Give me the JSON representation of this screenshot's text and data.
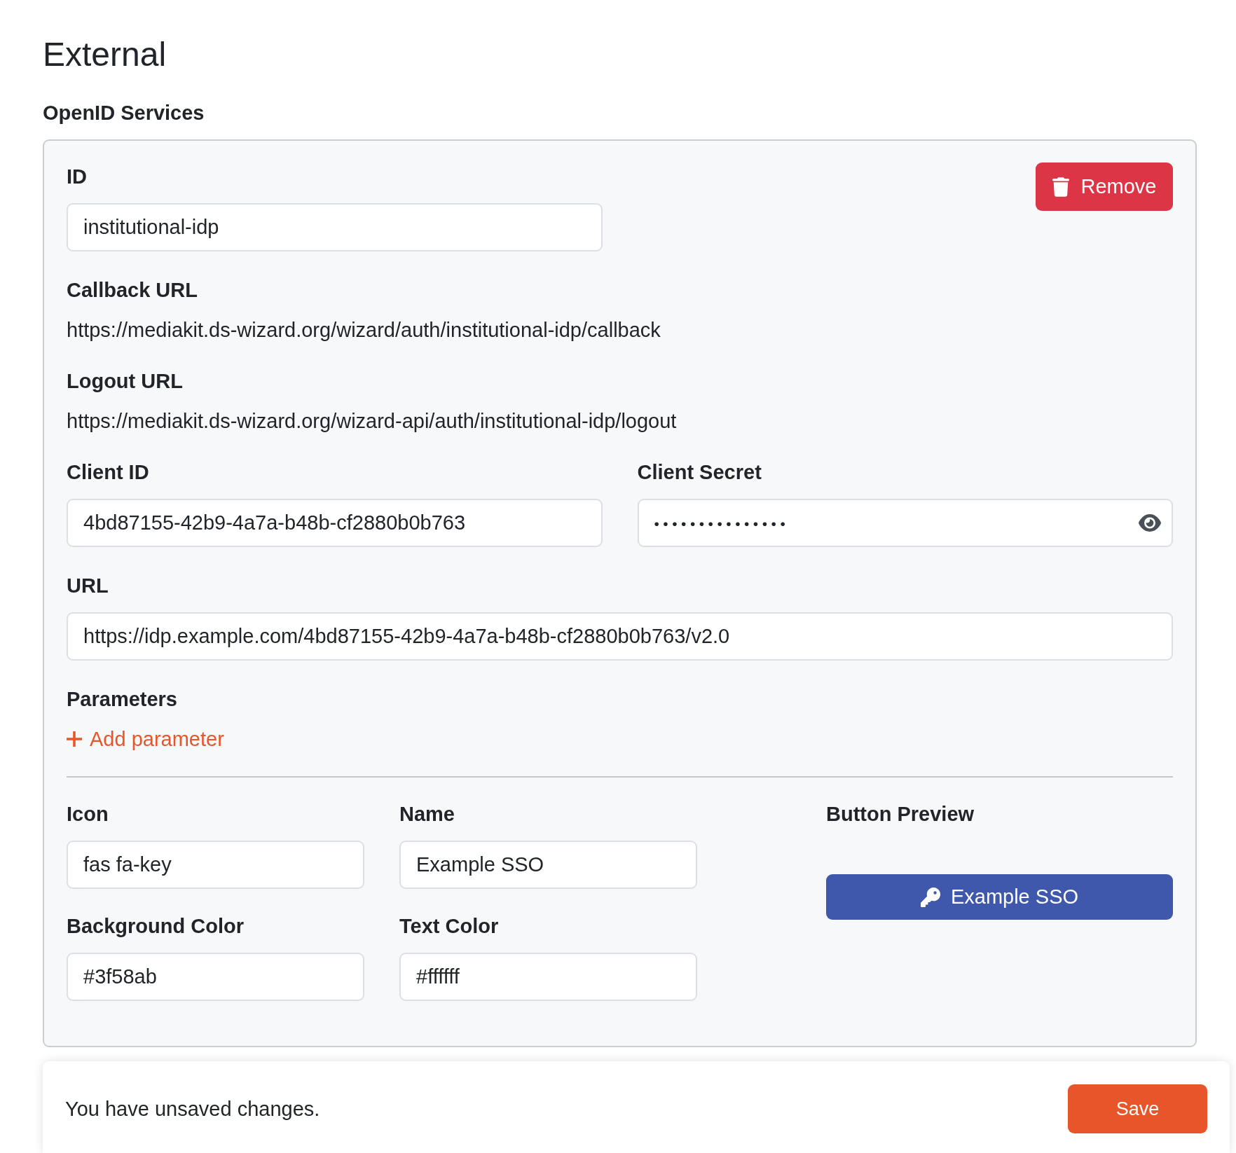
{
  "page": {
    "title": "External"
  },
  "openid_services": {
    "title": "OpenID Services",
    "items": [
      {
        "id": {
          "label": "ID",
          "value": "institutional-idp"
        },
        "remove_button": "Remove",
        "callback_url": {
          "label": "Callback URL",
          "value": "https://mediakit.ds-wizard.org/wizard/auth/institutional-idp/callback"
        },
        "logout_url": {
          "label": "Logout URL",
          "value": "https://mediakit.ds-wizard.org/wizard-api/auth/institutional-idp/logout"
        },
        "client_id": {
          "label": "Client ID",
          "value": "4bd87155-42b9-4a7a-b48b-cf2880b0b763"
        },
        "client_secret": {
          "label": "Client Secret",
          "value": "•••••••••••••••"
        },
        "url": {
          "label": "URL",
          "value": "https://idp.example.com/4bd87155-42b9-4a7a-b48b-cf2880b0b763/v2.0"
        },
        "parameters": {
          "label": "Parameters",
          "add_button": "Add parameter"
        },
        "icon": {
          "label": "Icon",
          "value": "fas fa-key"
        },
        "name": {
          "label": "Name",
          "value": "Example SSO"
        },
        "background_color": {
          "label": "Background Color",
          "value": "#3f58ab"
        },
        "text_color": {
          "label": "Text Color",
          "value": "#ffffff"
        },
        "button_preview": {
          "label": "Button Preview",
          "button": "Example SSO"
        }
      }
    ]
  },
  "save_bar": {
    "message": "You have unsaved changes.",
    "save_button": "Save"
  }
}
